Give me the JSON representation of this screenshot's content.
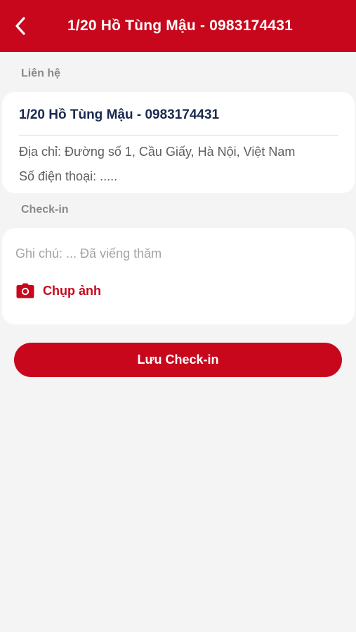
{
  "header": {
    "title": "1/20 Hồ Tùng Mậu - 0983174431",
    "back_icon": "chevron-left-icon"
  },
  "contact": {
    "section_label": "Liên hệ",
    "name": "1/20 Hồ Tùng Mậu - 0983174431",
    "address": "Địa chỉ:  Đường số 1, Cầu Giấy, Hà Nội, Việt Nam",
    "phone": "Số điện thoại: ....."
  },
  "checkin": {
    "section_label": "Check-in",
    "note_placeholder": "Ghi chú: ... Đã viếng thăm",
    "photo_label": "Chụp ảnh",
    "photo_icon": "camera-icon"
  },
  "save_button_label": "Lưu Check-in",
  "colors": {
    "brand_red": "#c8071c",
    "background": "#f4f4f4",
    "card": "#ffffff",
    "contact_name": "#1a2a4f"
  }
}
